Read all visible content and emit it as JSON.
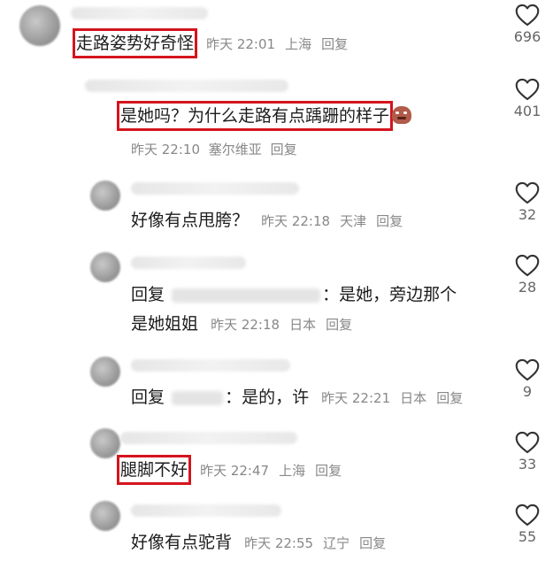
{
  "comments": [
    {
      "text": "走路姿势好奇怪",
      "time": "昨天 22:01",
      "location": "上海",
      "reply": "回复",
      "likes": "696"
    },
    {
      "text": "是她吗？为什么走路有点踽跚的样子",
      "time": "昨天 22:10",
      "location": "塞尔维亚",
      "reply": "回复",
      "likes": "401",
      "emoji": "angry-face-emoji"
    },
    {
      "text": "好像有点甩胯？",
      "time": "昨天 22:18",
      "location": "天津",
      "reply": "回复",
      "likes": "32"
    },
    {
      "reply_prefix": "回复",
      "text_line1": "：是她，旁边那个",
      "text_line2": "是她姐姐",
      "time": "昨天 22:18",
      "location": "日本",
      "reply": "回复",
      "likes": "28"
    },
    {
      "reply_prefix": "回复",
      "text": "：是的，许",
      "time": "昨天 22:21",
      "location": "日本",
      "reply": "回复",
      "likes": "9"
    },
    {
      "text": "腿脚不好",
      "time": "昨天 22:47",
      "location": "上海",
      "reply": "回复",
      "likes": "33"
    },
    {
      "text": "好像有点驼背",
      "time": "昨天 22:55",
      "location": "辽宁",
      "reply": "回复",
      "likes": "55"
    }
  ],
  "icons": {
    "like": "heart-outline-icon"
  },
  "colors": {
    "highlight": "#d4141e",
    "meta": "#888888",
    "text": "#1c1c1c"
  }
}
